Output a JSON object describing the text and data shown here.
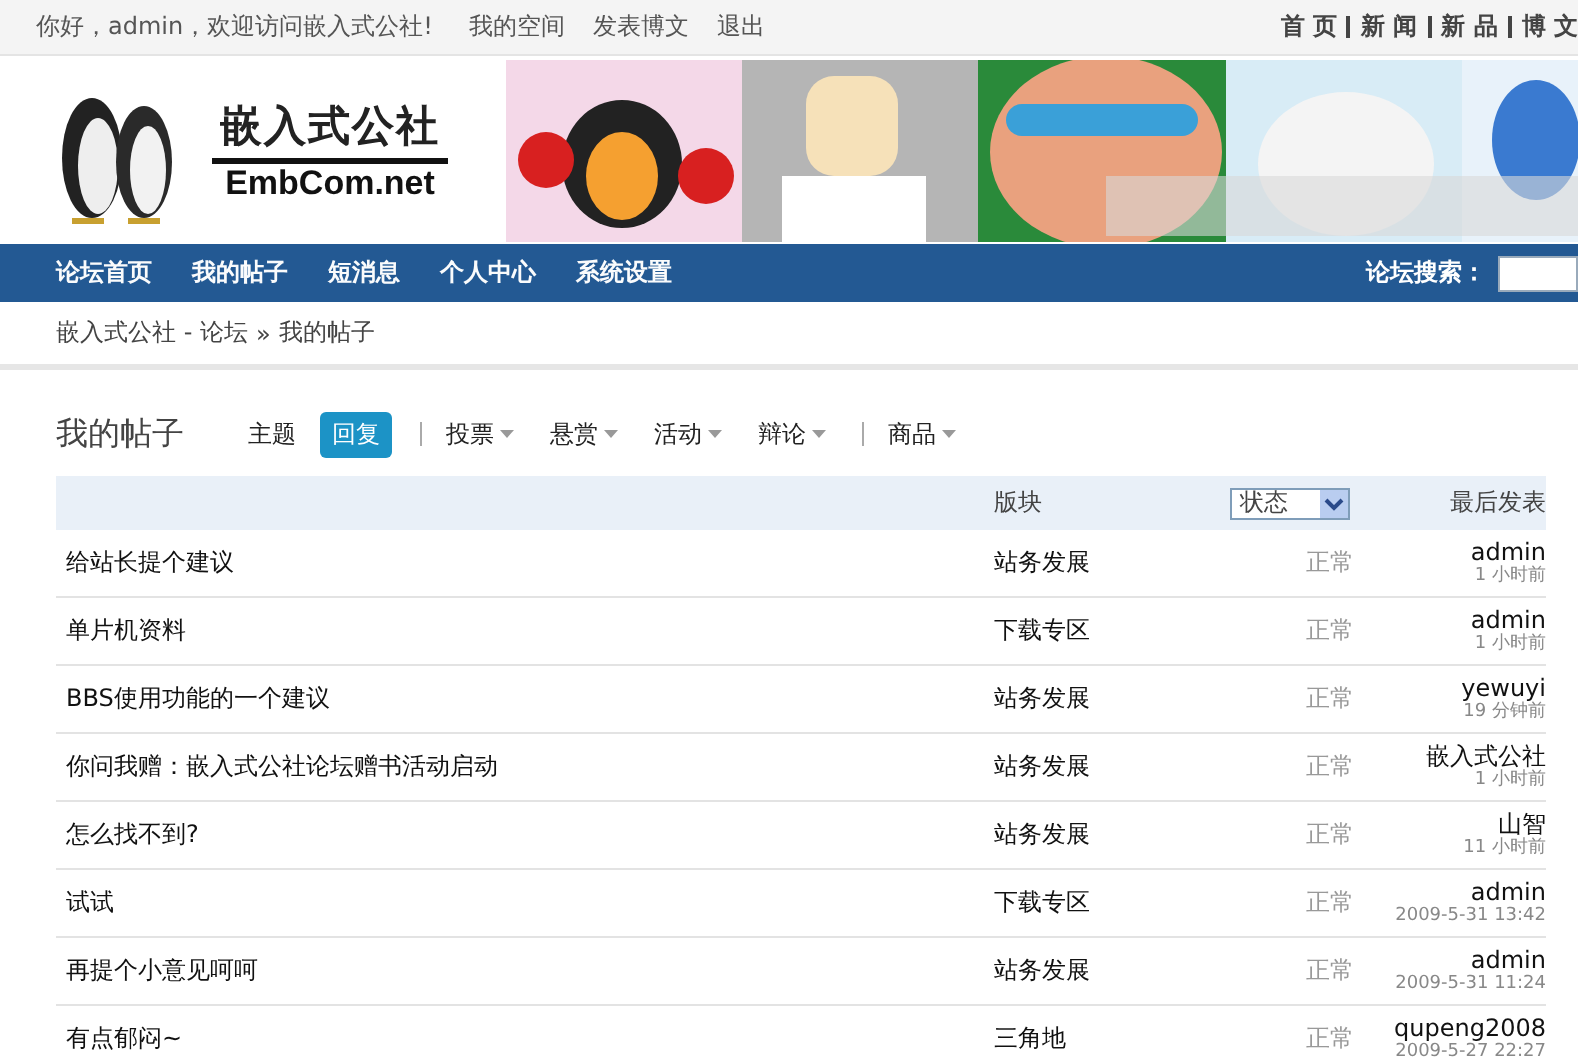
{
  "top_bar": {
    "greeting": "你好，admin，欢迎访问嵌入式公社!",
    "links": [
      "我的空间",
      "发表博文",
      "退出"
    ],
    "site_links": [
      "首 页",
      "新 闻",
      "新 品",
      "博 文"
    ]
  },
  "logo": {
    "name": "嵌入式公社",
    "domain": "EmbCom.net"
  },
  "nav": {
    "items": [
      {
        "label": "论坛首页"
      },
      {
        "label": "我的帖子"
      },
      {
        "label": "短消息"
      },
      {
        "label": "个人中心"
      },
      {
        "label": "系统设置"
      }
    ],
    "search_label": "论坛搜索："
  },
  "breadcrumb": {
    "site": "嵌入式公社 - 论坛",
    "separator": "»",
    "current": "我的帖子"
  },
  "page_title": "我的帖子",
  "tabs": [
    {
      "label": "主题",
      "selected": false,
      "has_menu": false,
      "divider_before": false
    },
    {
      "label": "回复",
      "selected": true,
      "has_menu": false,
      "divider_before": false
    },
    {
      "label": "投票",
      "selected": false,
      "has_menu": true,
      "divider_before": true
    },
    {
      "label": "悬赏",
      "selected": false,
      "has_menu": true,
      "divider_before": false
    },
    {
      "label": "活动",
      "selected": false,
      "has_menu": true,
      "divider_before": false
    },
    {
      "label": "辩论",
      "selected": false,
      "has_menu": true,
      "divider_before": false
    },
    {
      "label": "商品",
      "selected": false,
      "has_menu": true,
      "divider_before": true
    }
  ],
  "table": {
    "columns": {
      "forum": "版块",
      "status_filter": "状态",
      "last_post": "最后发表"
    },
    "rows": [
      {
        "subject": "给站长提个建议",
        "forum": "站务发展",
        "status": "正常",
        "author": "admin",
        "time": "1 小时前"
      },
      {
        "subject": "单片机资料",
        "forum": "下载专区",
        "status": "正常",
        "author": "admin",
        "time": "1 小时前"
      },
      {
        "subject": "BBS使用功能的一个建议",
        "forum": "站务发展",
        "status": "正常",
        "author": "yewuyi",
        "time": "19 分钟前"
      },
      {
        "subject": "你问我赠：嵌入式公社论坛赠书活动启动",
        "forum": "站务发展",
        "status": "正常",
        "author": "嵌入式公社",
        "time": "1 小时前"
      },
      {
        "subject": "怎么找不到?",
        "forum": "站务发展",
        "status": "正常",
        "author": "山智",
        "time": "11 小时前"
      },
      {
        "subject": "试试",
        "forum": "下载专区",
        "status": "正常",
        "author": "admin",
        "time": "2009-5-31 13:42"
      },
      {
        "subject": "再提个小意见呵呵",
        "forum": "站务发展",
        "status": "正常",
        "author": "admin",
        "time": "2009-5-31 11:24"
      },
      {
        "subject": "有点郁闷~",
        "forum": "三角地",
        "status": "正常",
        "author": "qupeng2008",
        "time": "2009-5-27 22:27"
      }
    ]
  }
}
